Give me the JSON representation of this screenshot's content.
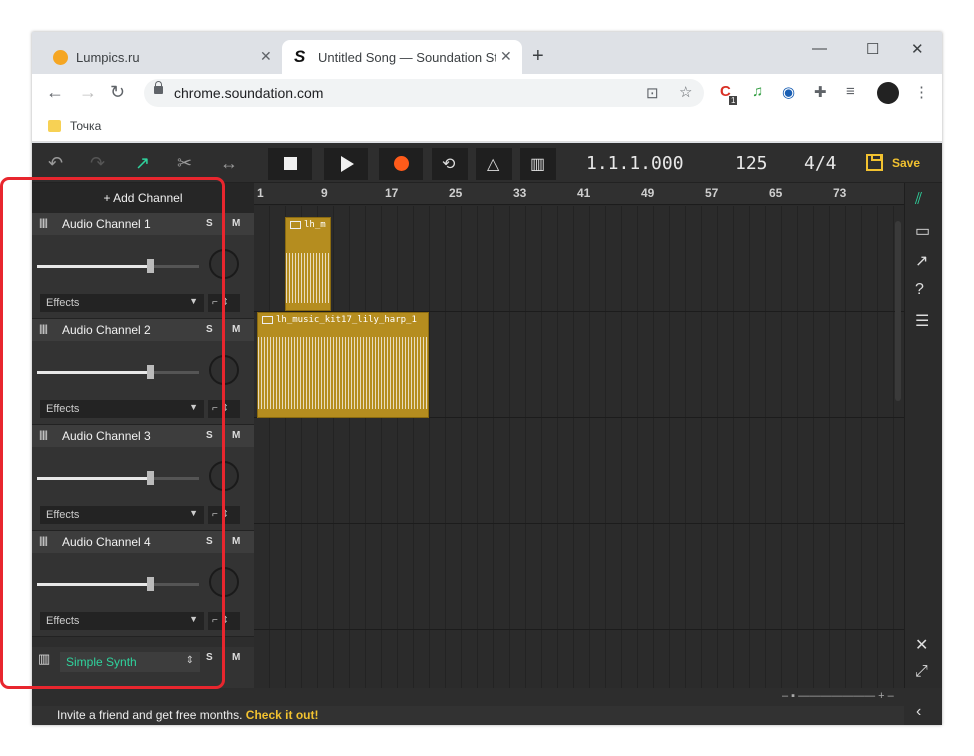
{
  "browser": {
    "tabs": [
      {
        "title": "Lumpics.ru",
        "close": "✕"
      },
      {
        "title": "Untitled Song — Soundation Stu",
        "close": "✕"
      }
    ],
    "new_tab": "+",
    "window_controls": {
      "minimize": "—",
      "maximize": "☐",
      "close": "✕"
    },
    "nav": {
      "back": "←",
      "forward": "→",
      "reload": "↻"
    },
    "url": "chrome.soundation.com",
    "bookmark": "Точка",
    "ext_badge": "1"
  },
  "app": {
    "transport": {
      "position": "1.1.1.000",
      "tempo": "125",
      "time_signature": "4/4",
      "save_label": "Save"
    },
    "add_channel": "+ Add Channel",
    "channels": [
      {
        "name": "Audio Channel 1",
        "solo": "S",
        "mute": "M",
        "effects": "Effects",
        "volume": 0.7
      },
      {
        "name": "Audio Channel 2",
        "solo": "S",
        "mute": "M",
        "effects": "Effects",
        "volume": 0.7
      },
      {
        "name": "Audio Channel 3",
        "solo": "S",
        "mute": "M",
        "effects": "Effects",
        "volume": 0.7
      },
      {
        "name": "Audio Channel 4",
        "solo": "S",
        "mute": "M",
        "effects": "Effects",
        "volume": 0.7
      }
    ],
    "synth": {
      "name": "Simple Synth",
      "solo": "S",
      "mute": "M"
    },
    "ruler": [
      "1",
      "9",
      "17",
      "25",
      "33",
      "41",
      "49",
      "57",
      "65",
      "73"
    ],
    "clips": [
      {
        "label": "lh_m"
      },
      {
        "label": "lh_music_kit17_lily_harp_1"
      }
    ],
    "invite": {
      "text": "Invite a friend and get free months.",
      "link": "Check it out!"
    }
  }
}
